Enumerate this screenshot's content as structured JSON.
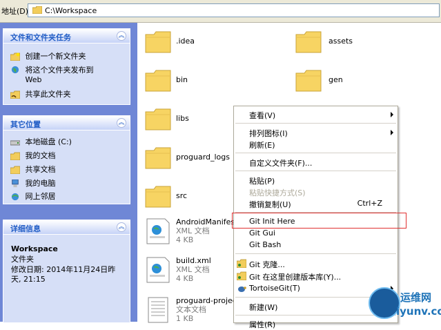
{
  "address_bar": {
    "label": "地址(D)",
    "path": "C:\\Workspace"
  },
  "tasks_panel": {
    "title": "文件和文件夹任务",
    "items": [
      {
        "label": "创建一个新文件夹",
        "icon": "new-folder-icon"
      },
      {
        "label": "将这个文件夹发布到 Web",
        "icon": "publish-web-icon"
      },
      {
        "label": "共享此文件夹",
        "icon": "share-folder-icon"
      }
    ]
  },
  "places_panel": {
    "title": "其它位置",
    "items": [
      {
        "label": "本地磁盘 (C:)",
        "icon": "drive-icon"
      },
      {
        "label": "我的文档",
        "icon": "folder-icon"
      },
      {
        "label": "共享文档",
        "icon": "folder-icon"
      },
      {
        "label": "我的电脑",
        "icon": "computer-icon"
      },
      {
        "label": "网上邻居",
        "icon": "network-icon"
      }
    ]
  },
  "details_panel": {
    "title": "详细信息",
    "name": "Workspace",
    "type": "文件夹",
    "modified_label": "修改日期: 2014年11月24日昨天, 21:15"
  },
  "folders": [
    {
      "name": ".idea"
    },
    {
      "name": "assets"
    },
    {
      "name": "bin"
    },
    {
      "name": "gen"
    },
    {
      "name": "libs"
    },
    {
      "name": "proguard_logs"
    },
    {
      "name": "src"
    }
  ],
  "files": [
    {
      "name": "AndroidManifest",
      "type": "XML 文档",
      "size": "4 KB",
      "icon": "xml-file-icon"
    },
    {
      "name": "build.xml",
      "type": "XML 文档",
      "size": "4 KB",
      "icon": "xml-file-icon"
    },
    {
      "name": "proguard-project",
      "type": "文本文档",
      "size": "1 KB",
      "icon": "text-file-icon"
    }
  ],
  "context_menu": {
    "view": "查看(V)",
    "arrange": "排列图标(I)",
    "refresh": "刷新(E)",
    "customize": "自定义文件夹(F)...",
    "paste": "粘贴(P)",
    "paste_shortcut": "粘贴快捷方式(S)",
    "undo_copy": "撤销复制(U)",
    "undo_shortcut": "Ctrl+Z",
    "git_init": "Git Init Here",
    "git_gui": "Git Gui",
    "git_bash": "Git Bash",
    "git_clone": "Git 克隆...",
    "git_create_repo": "Git 在这里创建版本库(Y)...",
    "tortoise": "TortoiseGit(T)",
    "new": "新建(W)",
    "properties": "属性(R)"
  },
  "watermark": {
    "line1": "运维网",
    "line2": "iyunv.com"
  },
  "colors": {
    "task_pane_bg": "#6f87d6",
    "panel_bg": "#d6dff7",
    "panel_title": "#215dc6",
    "highlight_box": "#e03030",
    "folder_yellow": "#f7d463"
  }
}
